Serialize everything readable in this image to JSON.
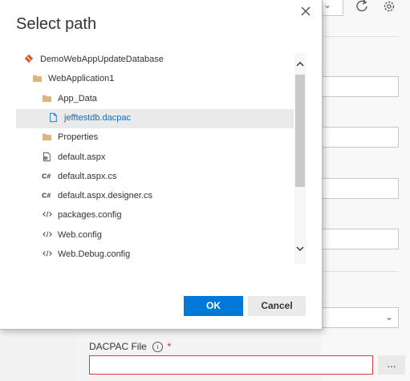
{
  "dialog": {
    "title": "Select path",
    "ok_label": "OK",
    "cancel_label": "Cancel"
  },
  "tree": {
    "items": [
      {
        "label": "DemoWebAppUpdateDatabase",
        "icon": "git-repo-icon",
        "depth": 0,
        "selected": false
      },
      {
        "label": "WebApplication1",
        "icon": "folder-icon",
        "depth": 1,
        "selected": false
      },
      {
        "label": "App_Data",
        "icon": "folder-icon",
        "depth": 2,
        "selected": false
      },
      {
        "label": "jefftestdb.dacpac",
        "icon": "file-icon",
        "depth": 3,
        "selected": true
      },
      {
        "label": "Properties",
        "icon": "folder-icon",
        "depth": 2,
        "selected": false
      },
      {
        "label": "default.aspx",
        "icon": "aspx-file-icon",
        "depth": 2,
        "selected": false
      },
      {
        "label": "default.aspx.cs",
        "icon": "csharp-file-icon",
        "depth": 2,
        "selected": false
      },
      {
        "label": "default.aspx.designer.cs",
        "icon": "csharp-file-icon",
        "depth": 2,
        "selected": false
      },
      {
        "label": "packages.config",
        "icon": "code-file-icon",
        "depth": 2,
        "selected": false
      },
      {
        "label": "Web.config",
        "icon": "code-file-icon",
        "depth": 2,
        "selected": false
      },
      {
        "label": "Web.Debug.config",
        "icon": "code-file-icon",
        "depth": 2,
        "selected": false
      }
    ]
  },
  "background": {
    "dacpac_label": "DACPAC File",
    "required_mark": "*",
    "info_glyph": "i",
    "browse_label": "..."
  },
  "colors": {
    "accent": "#0078d7",
    "selected_text": "#106ebe",
    "git_icon": "#e04e2b",
    "folder": "#dcb67a",
    "error_border": "#d53c3c"
  }
}
